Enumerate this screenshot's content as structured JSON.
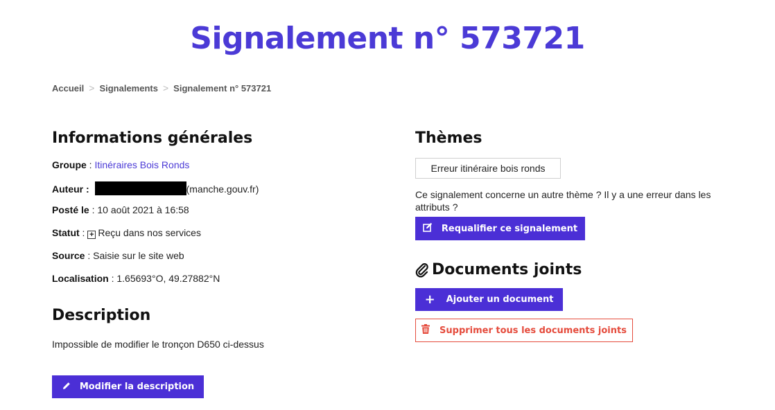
{
  "page": {
    "title": "Signalement n° 573721"
  },
  "breadcrumb": {
    "items": [
      "Accueil",
      "Signalements",
      "Signalement n° 573721"
    ],
    "separator": ">"
  },
  "general": {
    "title": "Informations générales",
    "groupe_label": "Groupe",
    "groupe_value": "Itinéraires Bois Ronds",
    "auteur_label": "Auteur",
    "auteur_suffix": "(manche.gouv.fr)",
    "poste_label": "Posté le",
    "poste_value": "10 août 2021 à 16:58",
    "statut_label": "Statut",
    "statut_value": "Reçu dans nos services",
    "source_label": "Source",
    "source_value": "Saisie sur le site web",
    "localisation_label": "Localisation",
    "localisation_value": "1.65693°O, 49.27882°N",
    "separator": " : "
  },
  "description": {
    "title": "Description",
    "text": "Impossible de modifier le tronçon D650 ci-dessus",
    "edit_button": "Modifier la description"
  },
  "themes": {
    "title": "Thèmes",
    "tag": "Erreur itinéraire bois ronds",
    "note": "Ce signalement concerne un autre thème ? Il y a une erreur dans les attributs ?",
    "requalify_button": "Requalifier ce signalement"
  },
  "documents": {
    "title": "Documents joints",
    "add_button": "Ajouter un document",
    "delete_all_button": "Supprimer tous les documents joints"
  },
  "colors": {
    "primary": "#4b2fd6",
    "danger": "#e54b3c",
    "link": "#4b3ad6"
  },
  "icons": {
    "edit": "pencil-icon",
    "requalify": "edit-square-icon",
    "attachment": "paperclip-icon",
    "add": "plus-icon",
    "delete": "trash-icon",
    "status": "plus-square-icon"
  }
}
